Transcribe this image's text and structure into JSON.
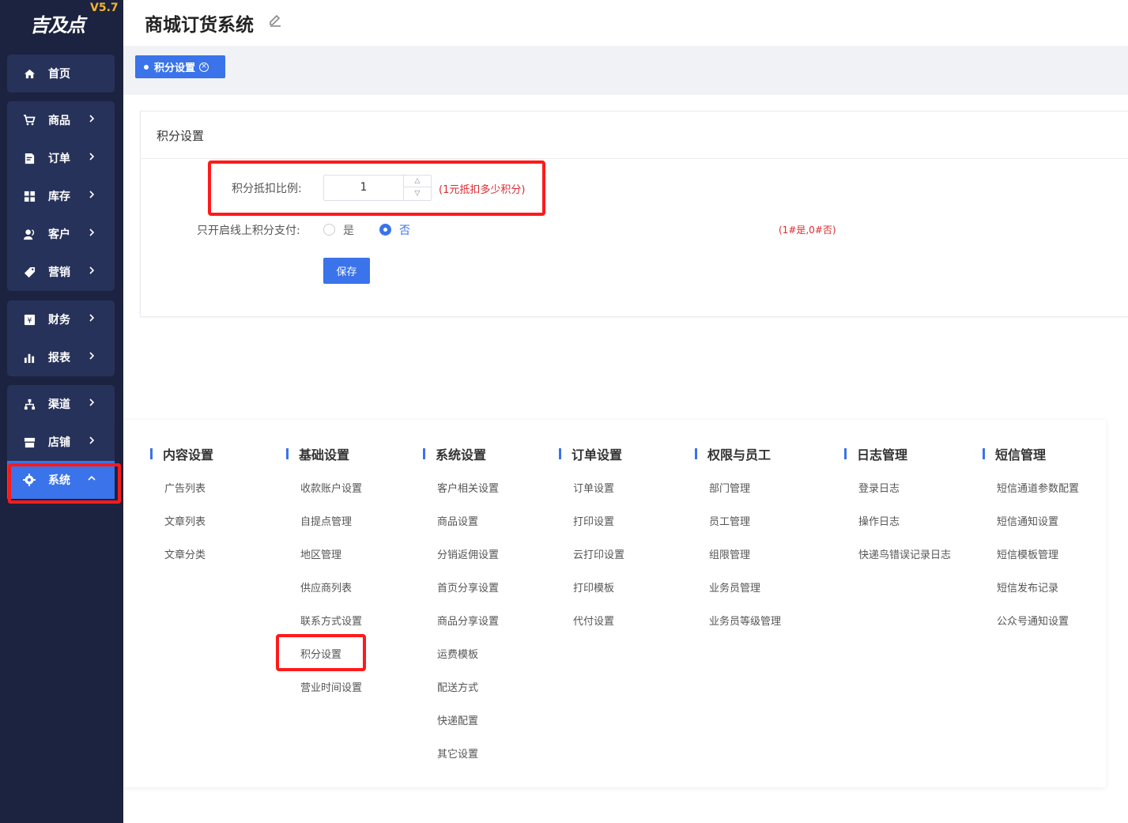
{
  "brand": {
    "logo": "吉及点",
    "version": "V5.7"
  },
  "sidebar": {
    "groups": [
      [
        {
          "label": "首页",
          "icon": "home-icon"
        }
      ],
      [
        {
          "label": "商品",
          "icon": "cart-icon"
        },
        {
          "label": "订单",
          "icon": "order-icon"
        },
        {
          "label": "库存",
          "icon": "inventory-icon"
        },
        {
          "label": "客户",
          "icon": "customer-icon"
        },
        {
          "label": "营销",
          "icon": "tag-icon"
        }
      ],
      [
        {
          "label": "财务",
          "icon": "finance-icon"
        },
        {
          "label": "报表",
          "icon": "chart-icon"
        }
      ],
      [
        {
          "label": "渠道",
          "icon": "channel-icon"
        },
        {
          "label": "店铺",
          "icon": "store-icon"
        },
        {
          "label": "系统",
          "icon": "gear-icon",
          "active": true
        }
      ]
    ]
  },
  "header": {
    "title": "商城订货系统"
  },
  "tabs": [
    {
      "label": "积分设置",
      "active": true
    }
  ],
  "card": {
    "title": "积分设置",
    "ratio_label": "积分抵扣比例:",
    "ratio_value": "1",
    "ratio_hint": "(1元抵扣多少积分)",
    "online_label": "只开启线上积分支付:",
    "option_yes": "是",
    "option_no": "否",
    "selected": "否",
    "online_hint": "(1#是,0#否)",
    "save_label": "保存"
  },
  "menu": {
    "columns": [
      {
        "title": "内容设置",
        "items": [
          "广告列表",
          "文章列表",
          "文章分类"
        ]
      },
      {
        "title": "基础设置",
        "items": [
          "收款账户设置",
          "自提点管理",
          "地区管理",
          "供应商列表",
          "联系方式设置",
          "积分设置",
          "营业时间设置"
        ]
      },
      {
        "title": "系统设置",
        "items": [
          "客户相关设置",
          "商品设置",
          "分销返佣设置",
          "首页分享设置",
          "商品分享设置",
          "运费模板",
          "配送方式",
          "快递配置",
          "其它设置"
        ]
      },
      {
        "title": "订单设置",
        "items": [
          "订单设置",
          "打印设置",
          "云打印设置",
          "打印模板",
          "代付设置"
        ]
      },
      {
        "title": "权限与员工",
        "items": [
          "部门管理",
          "员工管理",
          "组限管理",
          "业务员管理",
          "业务员等级管理"
        ]
      },
      {
        "title": "日志管理",
        "items": [
          "登录日志",
          "操作日志",
          "快递鸟错误记录日志"
        ]
      },
      {
        "title": "短信管理",
        "items": [
          "短信通道参数配置",
          "短信通知设置",
          "短信模板管理",
          "短信发布记录",
          "公众号通知设置"
        ]
      }
    ]
  },
  "colors": {
    "sidebar_bg": "#1c2340",
    "group_bg": "#27325a",
    "accent": "#3a73ea",
    "highlight": "#ff1a1a",
    "hint": "#e0282e"
  }
}
